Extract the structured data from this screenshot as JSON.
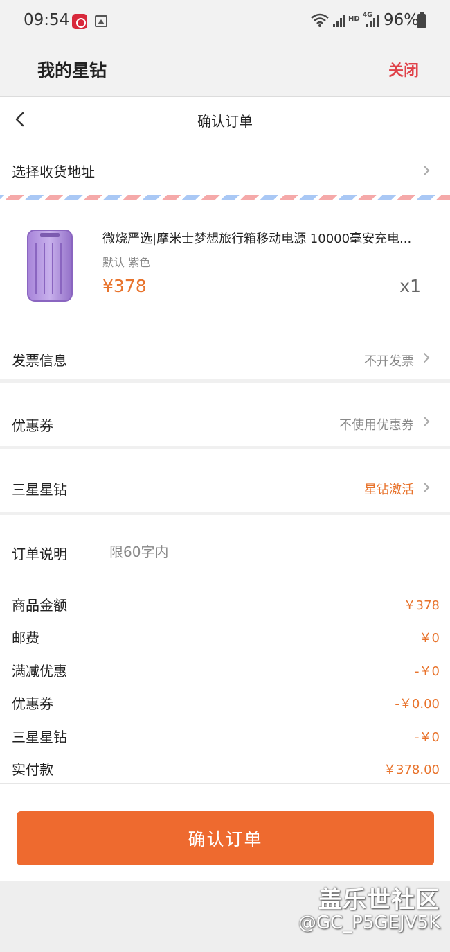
{
  "status_bar": {
    "time": "09:54",
    "battery": "96%",
    "hd": "HD",
    "network": "4G"
  },
  "app_header": {
    "title": "我的星钻",
    "close_label": "关闭"
  },
  "nav": {
    "title": "确认订单"
  },
  "address": {
    "label": "选择收货地址"
  },
  "product": {
    "name": "微烧严选|摩米士梦想旅行箱移动电源 10000毫安充电...",
    "spec": "默认 紫色",
    "price": "¥378",
    "quantity": "x1"
  },
  "invoice": {
    "label": "发票信息",
    "value": "不开发票"
  },
  "coupon": {
    "label": "优惠券",
    "value": "不使用优惠券"
  },
  "samsung_diamond": {
    "label": "三星星钻",
    "value": "星钻激活"
  },
  "order_note": {
    "label": "订单说明",
    "placeholder": "限60字内"
  },
  "summary": [
    {
      "label": "商品金额",
      "value": "￥378"
    },
    {
      "label": "邮费",
      "value": "￥0"
    },
    {
      "label": "满减优惠",
      "value": "-￥0"
    },
    {
      "label": "优惠券",
      "value": "-￥0.00"
    },
    {
      "label": "三星星钻",
      "value": "-￥0"
    },
    {
      "label": "实付款",
      "value": "￥378.00"
    }
  ],
  "confirm_button": "确认订单",
  "watermark": {
    "title": "盖乐世社区",
    "handle": "@GC_P5GEJV5K"
  },
  "colors": {
    "accent": "#ee6a2f",
    "price": "#e8732c",
    "close": "#e0424a"
  }
}
